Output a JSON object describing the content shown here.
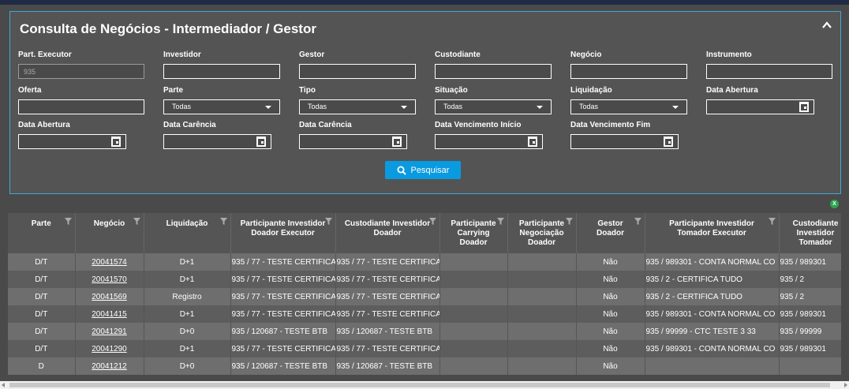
{
  "panel": {
    "title": "Consulta de Negócios - Intermediador / Gestor",
    "collapse_icon": "chevron-up-icon"
  },
  "form": {
    "part_executor": {
      "label": "Part. Executor",
      "value": "935"
    },
    "investidor": {
      "label": "Investidor",
      "value": ""
    },
    "gestor": {
      "label": "Gestor",
      "value": ""
    },
    "custodiante": {
      "label": "Custodiante",
      "value": ""
    },
    "negocio": {
      "label": "Negócio",
      "value": ""
    },
    "instrumento": {
      "label": "Instrumento",
      "value": ""
    },
    "oferta": {
      "label": "Oferta",
      "value": ""
    },
    "parte": {
      "label": "Parte",
      "value": "Todas"
    },
    "tipo": {
      "label": "Tipo",
      "value": "Todas"
    },
    "situacao": {
      "label": "Situação",
      "value": "Todas"
    },
    "liquidacao": {
      "label": "Liquidação",
      "value": "Todas"
    },
    "data_abertura_1": {
      "label": "Data Abertura",
      "value": ""
    },
    "data_abertura_2": {
      "label": "Data Abertura",
      "value": ""
    },
    "data_carencia_1": {
      "label": "Data Carência",
      "value": ""
    },
    "data_carencia_2": {
      "label": "Data Carência",
      "value": ""
    },
    "data_venc_inicio": {
      "label": "Data Vencimento Início",
      "value": ""
    },
    "data_venc_fim": {
      "label": "Data Vencimento Fim",
      "value": ""
    },
    "search_button": "Pesquisar",
    "excel_badge": "X"
  },
  "table": {
    "headers": [
      "Parte",
      "Negócio",
      "Liquidação",
      "Participante Investidor Doador Executor",
      "Custodiante Investidor Doador",
      "Participante Carrying Doador",
      "Participante Negociação Doador",
      "Gestor Doador",
      "Participante Investidor Tomador Executor",
      "Custodiante Investidor Tomador"
    ],
    "rows": [
      [
        "D/T",
        "20041574",
        "D+1",
        "935 / 77 - TESTE CERTIFICA",
        "935 / 77 - TESTE CERTIFICA",
        "",
        "",
        "Não",
        "935 / 989301 - CONTA NORMAL CO",
        "935 / 989301"
      ],
      [
        "D/T",
        "20041570",
        "D+1",
        "935 / 77 - TESTE CERTIFICA",
        "935 / 77 - TESTE CERTIFICA",
        "",
        "",
        "Não",
        "935 / 2 - CERTIFICA TUDO",
        "935 / 2"
      ],
      [
        "D/T",
        "20041569",
        "Registro",
        "935 / 77 - TESTE CERTIFICA",
        "935 / 77 - TESTE CERTIFICA",
        "",
        "",
        "Não",
        "935 / 2 - CERTIFICA TUDO",
        "935 / 2"
      ],
      [
        "D/T",
        "20041415",
        "D+1",
        "935 / 77 - TESTE CERTIFICA",
        "935 / 77 - TESTE CERTIFICA",
        "",
        "",
        "Não",
        "935 / 989301 - CONTA NORMAL CO",
        "935 / 989301"
      ],
      [
        "D/T",
        "20041291",
        "D+0",
        "935 / 120687 - TESTE BTB",
        "935 / 120687 - TESTE BTB",
        "",
        "",
        "Não",
        "935 / 99999 - CTC TESTE 3 33",
        "935 / 99999"
      ],
      [
        "D/T",
        "20041290",
        "D+1",
        "935 / 77 - TESTE CERTIFICA",
        "935 / 77 - TESTE CERTIFICA",
        "",
        "",
        "Não",
        "935 / 989301 - CONTA NORMAL CO",
        "935 / 989301"
      ],
      [
        "D",
        "20041212",
        "D+0",
        "935 / 120687 - TESTE BTB",
        "935 / 120687 - TESTE BTB",
        "",
        "",
        "Não",
        "",
        ""
      ]
    ]
  }
}
